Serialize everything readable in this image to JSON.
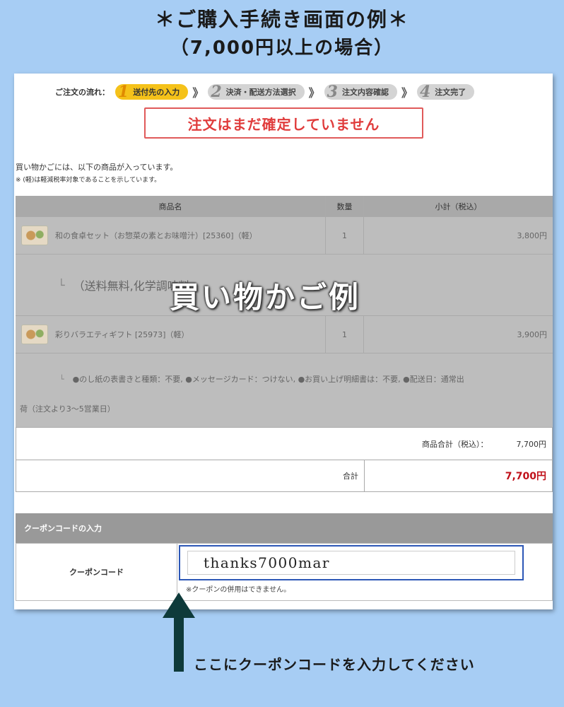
{
  "headline": {
    "line1": "＊ご購入手続き画面の例＊",
    "line2": "（7,000円以上の場合）"
  },
  "flow": {
    "label": "ご注文の流れ：",
    "steps": [
      {
        "num": "1",
        "label": "送付先の入力",
        "active": true
      },
      {
        "num": "2",
        "label": "決済・配送方法選択",
        "active": false
      },
      {
        "num": "3",
        "label": "注文内容確認",
        "active": false
      },
      {
        "num": "4",
        "label": "注文完了",
        "active": false
      }
    ],
    "separator": "》"
  },
  "notice": "注文はまだ確定していません",
  "intro": {
    "line1": "買い物かごには、以下の商品が入っています。",
    "line2": "※ (軽)は軽減税率対象であることを示しています。"
  },
  "cart": {
    "headers": [
      "商品名",
      "数量",
      "小計（税込）"
    ],
    "items": [
      {
        "name": "和の食卓セット（お惣菜の素とお味噌汁）[25360]（軽）",
        "qty": "1",
        "subtotal": "3,800円"
      },
      {
        "name": "彩りバラエティギフト [25973]（軽）",
        "qty": "1",
        "subtotal": "3,900円"
      }
    ],
    "option1": "（送料無料,化学調味料",
    "option2_a": "●のし紙の表書きと種類：不要, ●メッセージカード：つけない, ●お買い上げ明細書は：不要, ●配送日：通常出",
    "option2_b": "荷（注文より3～5営業日）",
    "arrow": "└",
    "product_total_label": "商品合計（税込）：",
    "product_total": "7,700円",
    "total_label": "合計",
    "total": "7,700円"
  },
  "overlay": "買い物かご例",
  "coupon": {
    "section_title": "クーポンコードの入力",
    "label": "クーポンコード",
    "value": "thanks7000mar",
    "note": "※クーポンの併用はできません。"
  },
  "instruction": "ここにクーポンコードを入力してください",
  "colors": {
    "background": "#a7cdf4",
    "active_step": "#f5c21a",
    "notice_red": "#e03c3c",
    "total_red": "#c0111a",
    "coupon_frame": "#2c57b6",
    "pointer": "#0e3a3a"
  }
}
